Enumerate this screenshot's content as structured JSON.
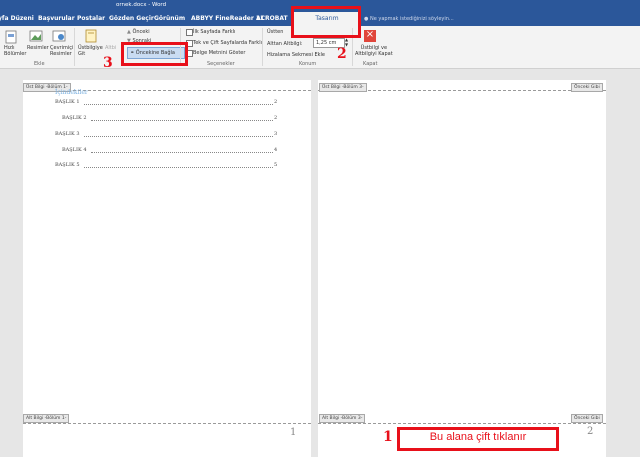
{
  "window_title": "ornek.docx - Word",
  "tabs": [
    "yfa Düzeni",
    "Başvurular",
    "Postalar",
    "Gözden Geçir",
    "Görünüm",
    "ABBYY FineReader 11",
    "ACROBAT",
    "Tasarım"
  ],
  "tell_me": "Ne yapmak istediğinizi söyleyin...",
  "ribbon": {
    "quick_parts": "Hızlı\nBölümler",
    "pictures": "Resimler",
    "online_pictures": "Çevrimiçi\nResimler",
    "goto_header": "Üstbilgiye\nGit",
    "goto_footer": "Altbi",
    "previous": "Önceki",
    "next": "Sonraki",
    "link_previous": "Öncekine Bağla",
    "opt1": "İlk Sayfada Farklı",
    "opt2": "Tek ve Çift Sayfalarda Farklı",
    "opt3": "Belge Metnini Göster",
    "header_from_top": "Üstten",
    "footer_from_bottom": "Alttan Altbilgi:",
    "footer_value": "1,25 cm",
    "insert_align_tab": "Hizalama Sekmesi Ekle",
    "close_label": "Üstbilgi ve\nAltbilgiyi Kapat",
    "groups": {
      "insert": "Ekle",
      "options": "Seçenekler",
      "position": "Konum",
      "close": "Kapat"
    }
  },
  "page1": {
    "header_tab": "Üst Bilgi -Bölüm 1-",
    "toc_title": "İçindekiler",
    "toc": [
      {
        "label": "BAŞLIK 1",
        "page": "2"
      },
      {
        "label": "BAŞLIK 2",
        "page": "2"
      },
      {
        "label": "BAŞLIK 3",
        "page": "3"
      },
      {
        "label": "BAŞLIK 4",
        "page": "4"
      },
      {
        "label": "BAŞLIK 5",
        "page": "5"
      }
    ],
    "footer_tab": "Alt Bilgi -Bölüm 1-",
    "page_number": "1"
  },
  "page2": {
    "header_tab": "Üst Bilgi -Bölüm 3-",
    "same_as_previous": "Önceki Gibi",
    "footer_tab": "Alt Bilgi -Bölüm 3-",
    "footer_same": "Önceki Gibi",
    "page_number": "2"
  },
  "annotations": {
    "n1": "1",
    "n2": "2",
    "n3": "3",
    "instruction": "Bu alana çift tıklanır"
  },
  "colors": {
    "accent": "#2b579a",
    "annotation_red": "#e8101a",
    "close_red": "#e0453a"
  }
}
